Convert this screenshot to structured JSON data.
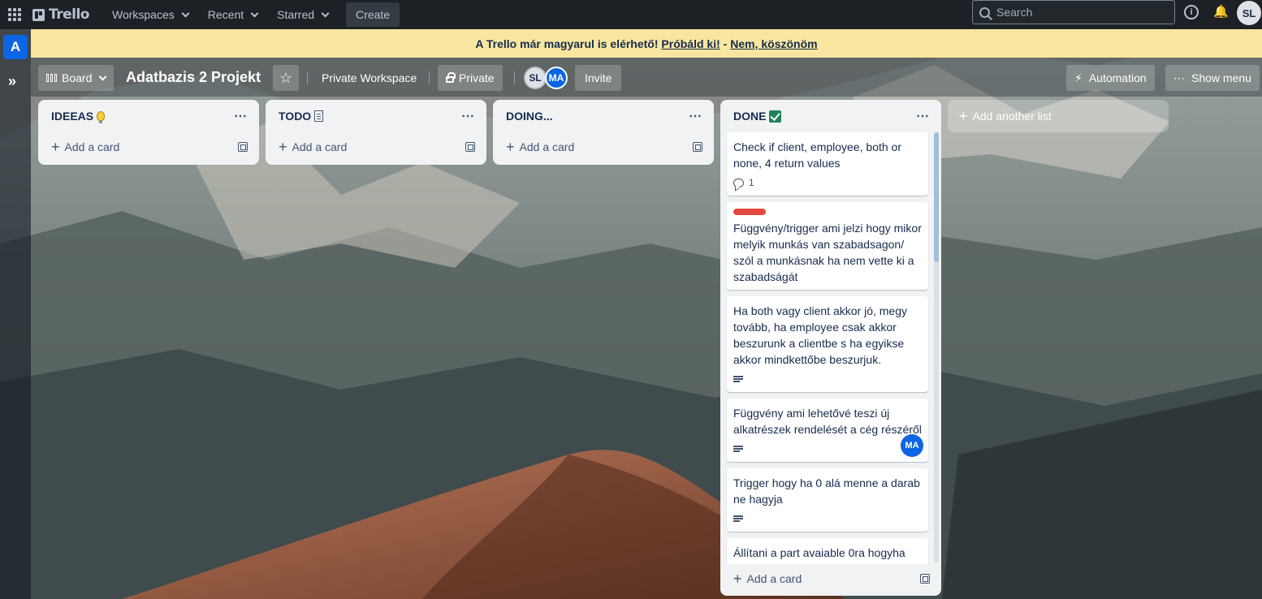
{
  "topnav": {
    "brand": "Trello",
    "items": [
      {
        "label": "Workspaces"
      },
      {
        "label": "Recent"
      },
      {
        "label": "Starred"
      }
    ],
    "create_label": "Create",
    "search_placeholder": "Search",
    "user_initials": "SL"
  },
  "banner": {
    "text": "A Trello már magyarul is elérhető!",
    "try_link": "Próbáld ki!",
    "separator": "-",
    "decline_link": "Nem, köszönöm"
  },
  "sidebar": {
    "workspace_initial": "A",
    "expand_label": "»"
  },
  "board_header": {
    "view_label": "Board",
    "title": "Adatbazis 2 Projekt",
    "workspace_label": "Private Workspace",
    "visibility_label": "Private",
    "members": [
      "SL",
      "MA"
    ],
    "invite_label": "Invite",
    "automation_label": "Automation",
    "show_menu_label": "Show menu"
  },
  "lists": [
    {
      "title": "IDEEAS",
      "add_card": "Add a card"
    },
    {
      "title": "TODO",
      "add_card": "Add a card"
    },
    {
      "title": "DOING...",
      "add_card": "Add a card"
    },
    {
      "title": "DONE",
      "add_card": "Add a card",
      "cards": [
        {
          "text": "Check if client, employee, both or none, 4 return values",
          "comments": "1"
        },
        {
          "text": "Függvény/trigger ami jelzi hogy mikor melyik munkás van szabadsagon/ szól a munkásnak ha nem vette ki a szabadságát",
          "label_color": "#e2483d"
        },
        {
          "text": "Ha both vagy client akkor jó, megy tovább, ha employee csak akkor beszurunk a clientbe s ha egyikse akkor mindkettőbe beszurjuk."
        },
        {
          "text": "Függvény ami lehetővé teszi új alkatrészek rendelését a cég részéről",
          "member": "MA"
        },
        {
          "text": "Trigger hogy ha 0 alá menne a darab ne hagyja"
        },
        {
          "text": "Állítani a part avaiable 0ra hogyha"
        }
      ]
    }
  ],
  "add_list_label": "Add another list",
  "colors": {
    "topnav_bg": "#1d2125",
    "banner_bg": "#f8e6a0",
    "list_bg": "#f1f2f4",
    "accent_blue": "#0c66e4",
    "label_red": "#e2483d",
    "done_green": "#1f845a"
  },
  "icons": {
    "ideeas_list": "light-bulb-icon",
    "todo_list": "memo-icon",
    "done_list": "check-mark-icon",
    "star": "star-icon",
    "automation": "lightning-icon",
    "show_menu": "ellipsis-icon"
  }
}
